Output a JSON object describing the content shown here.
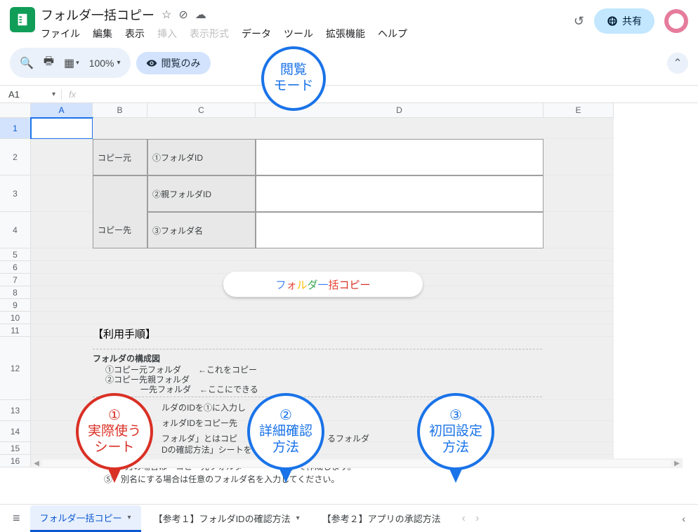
{
  "doc_title": "フォルダ一括コピー",
  "menu": [
    "ファイル",
    "編集",
    "表示",
    "挿入",
    "表示形式",
    "データ",
    "ツール",
    "拡張機能",
    "ヘルプ"
  ],
  "menu_disabled": [
    3,
    4
  ],
  "share_label": "共有",
  "zoom": "100%",
  "view_mode": "閲覧のみ",
  "namebox": "A1",
  "columns": [
    "A",
    "B",
    "C",
    "D",
    "E"
  ],
  "rows": [
    "1",
    "2",
    "3",
    "4",
    "5",
    "6",
    "7",
    "8",
    "9",
    "10",
    "11",
    "12",
    "13",
    "14",
    "15",
    "16"
  ],
  "table": {
    "r2b": "コピー元",
    "r2c": "①フォルダID",
    "r3b": "コピー先",
    "r3c": "②親フォルダID",
    "r4c": "③フォルダ名"
  },
  "pill_button": "フォルダ一括コピー",
  "instructions": {
    "heading": "【利用手順】",
    "sub1": "フォルダの構成図",
    "line1a": "①コピー元フォルダ",
    "line1b": "←これをコピー",
    "line2a": "②コピー先親フォルダ",
    "line3a": "一先フォルダ",
    "line3b": "←ここにできる",
    "line4": "ルダのIDを①に入力し",
    "line5": "ォルダIDをコピー先",
    "line6a": "フォルダ」とはコピ",
    "line6b": "るフォルダ",
    "line7": "Dの確認方法」シートを",
    "line8": "力の場合は「コピー元フォルダ　　　　ー）」で作成します。",
    "line9": "別名にする場合は任意のフォルダ名を入力してください。",
    "n5": "⑤"
  },
  "balloons": {
    "top": [
      "閲覧",
      "モード"
    ],
    "b1_num": "①",
    "b1": [
      "実際使う",
      "シート"
    ],
    "b2_num": "②",
    "b2": [
      "詳細確認",
      "方法"
    ],
    "b3_num": "③",
    "b3": [
      "初回設定",
      "方法"
    ]
  },
  "tabs": {
    "active": "フォルダ一括コピー",
    "t2": "【参考１】フォルダIDの確認方法",
    "t3": "【参考２】アプリの承認方法"
  }
}
